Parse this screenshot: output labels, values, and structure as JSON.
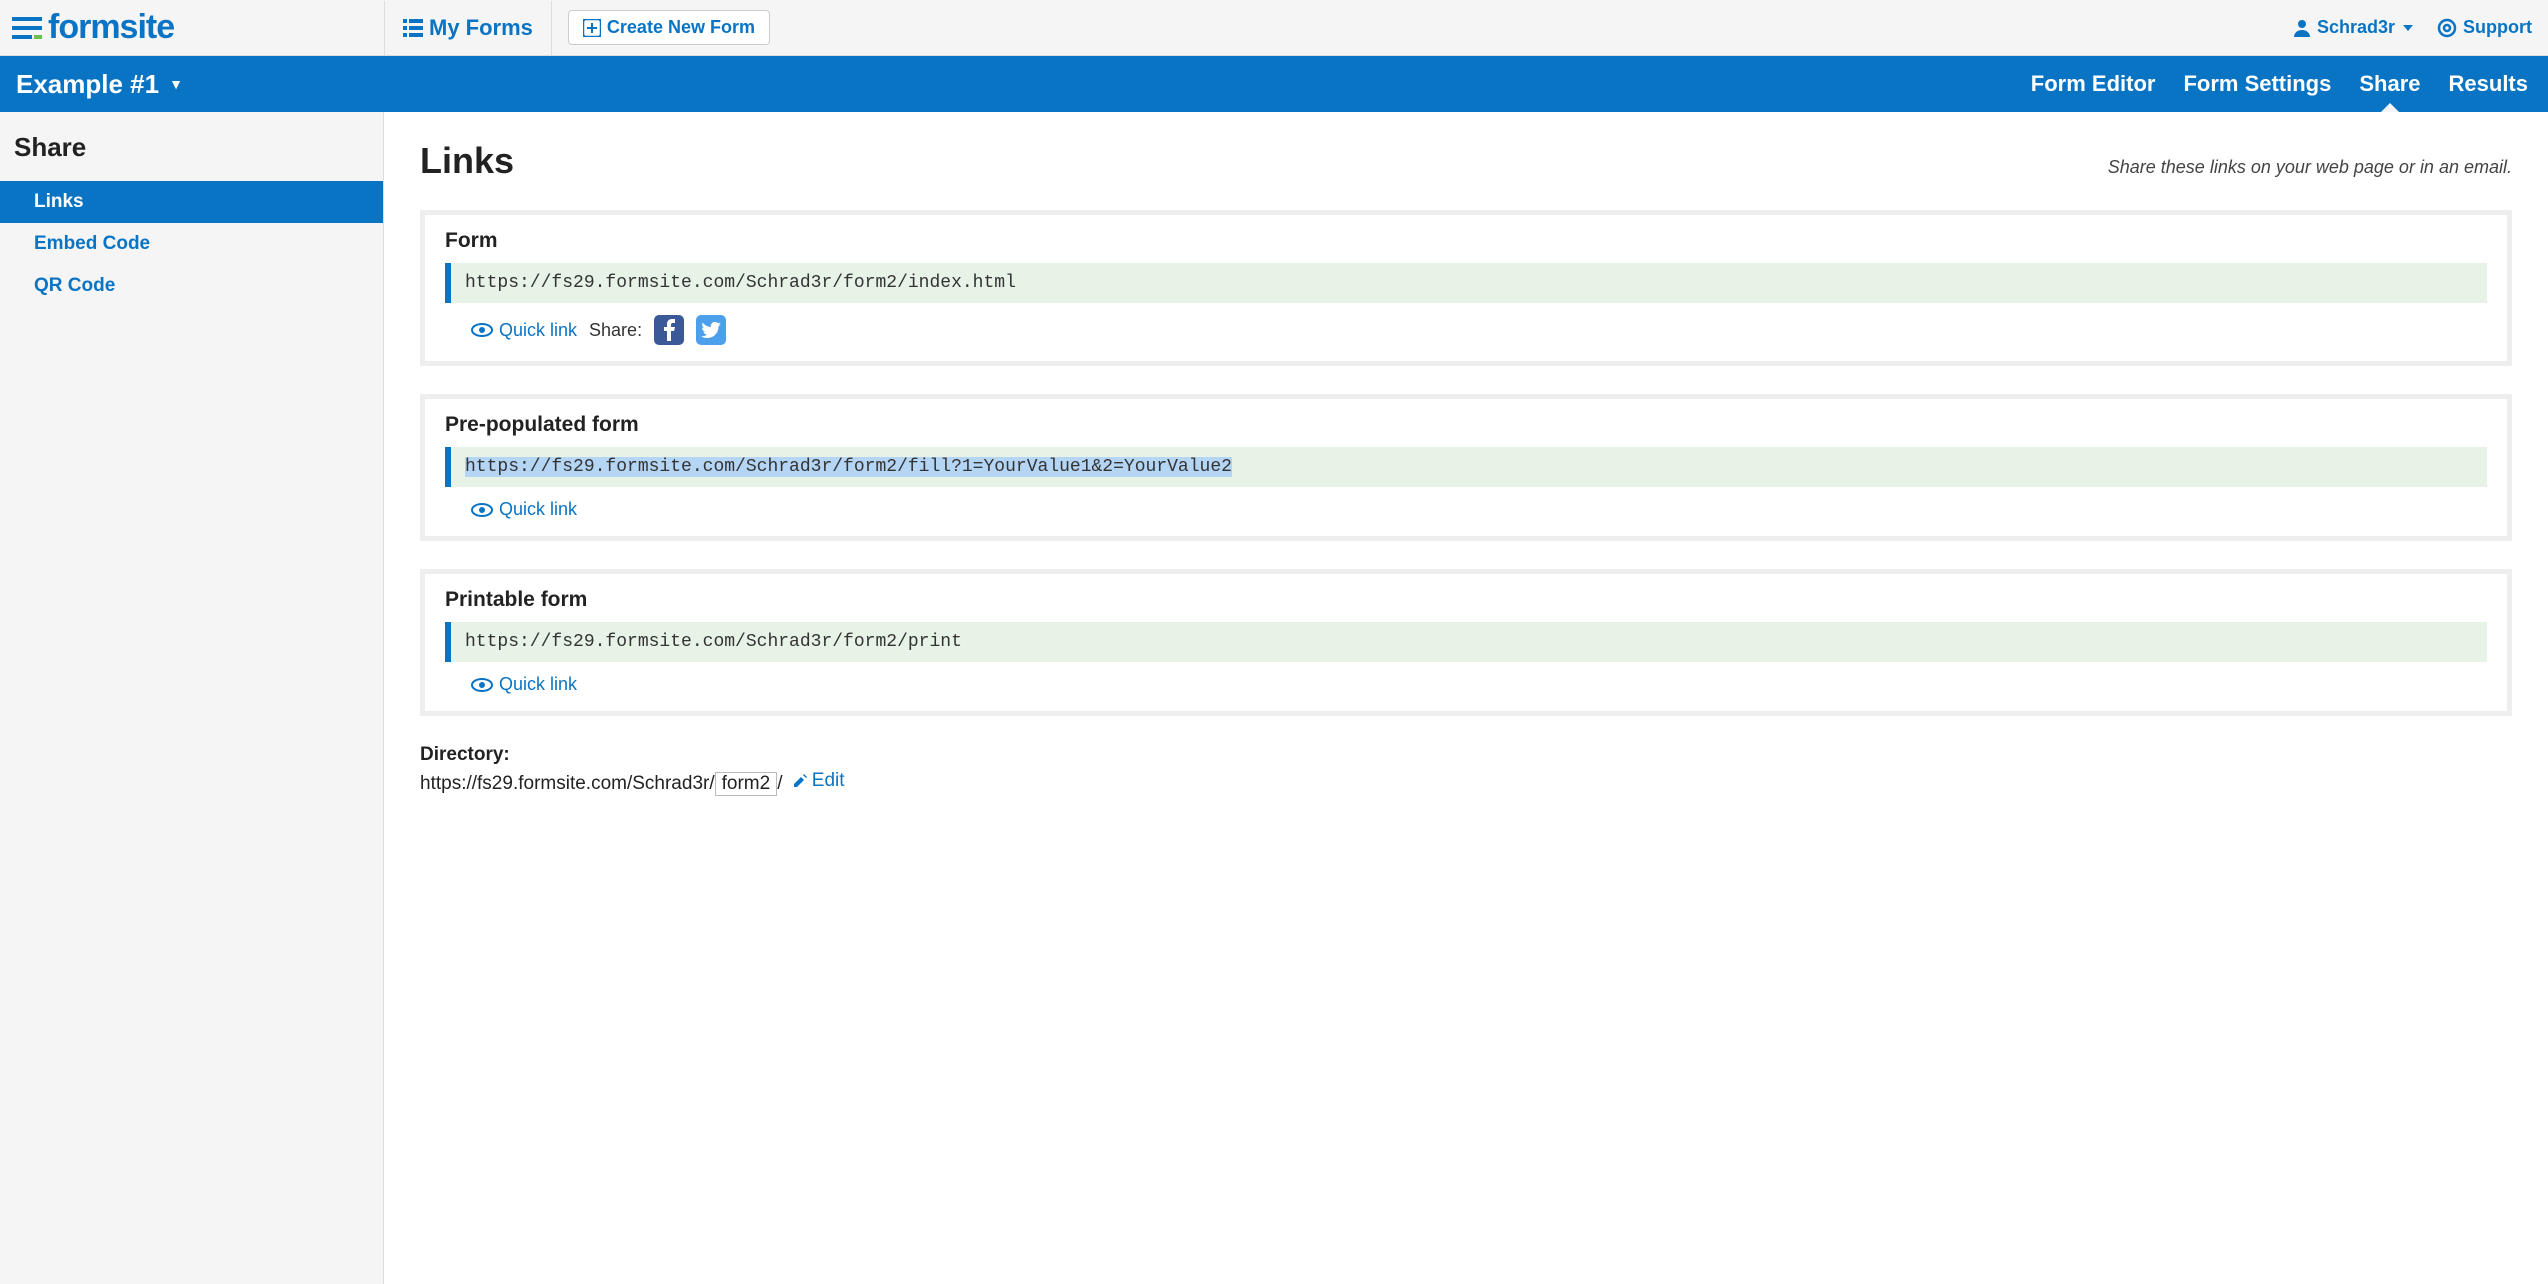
{
  "brand": "formsite",
  "topbar": {
    "myforms": "My Forms",
    "create": "Create New Form",
    "user": "Schrad3r",
    "support": "Support"
  },
  "bluebar": {
    "formname": "Example #1",
    "nav": {
      "editor": "Form Editor",
      "settings": "Form Settings",
      "share": "Share",
      "results": "Results"
    }
  },
  "sidebar": {
    "title": "Share",
    "items": {
      "links": "Links",
      "embed": "Embed Code",
      "qr": "QR Code"
    }
  },
  "page": {
    "title": "Links",
    "subtitle": "Share these links on your web page or in an email."
  },
  "cards": {
    "form": {
      "title": "Form",
      "url": "https://fs29.formsite.com/Schrad3r/form2/index.html",
      "quicklink": "Quick link",
      "share_label": "Share:"
    },
    "prepop": {
      "title": "Pre-populated form",
      "url": "https://fs29.formsite.com/Schrad3r/form2/fill?1=YourValue1&2=YourValue2",
      "quicklink": "Quick link"
    },
    "printable": {
      "title": "Printable form",
      "url": "https://fs29.formsite.com/Schrad3r/form2/print",
      "quicklink": "Quick link"
    }
  },
  "directory": {
    "label": "Directory:",
    "base": "https://fs29.formsite.com/Schrad3r/",
    "formdir": "form2",
    "slash": "/",
    "edit": "Edit"
  }
}
